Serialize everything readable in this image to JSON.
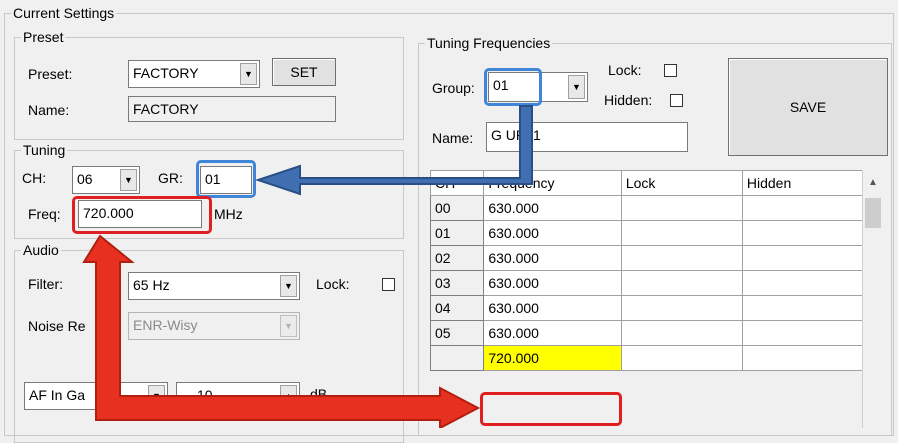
{
  "current_settings": {
    "title": "Current Settings"
  },
  "preset": {
    "title": "Preset",
    "preset_label": "Preset:",
    "preset_value": "FACTORY",
    "set_button": "SET",
    "name_label": "Name:",
    "name_value": "FACTORY"
  },
  "tuning": {
    "title": "Tuning",
    "ch_label": "CH:",
    "ch_value": "06",
    "gr_label": "GR:",
    "gr_value": "01",
    "freq_label": "Freq:",
    "freq_value": "720.000",
    "freq_unit": "MHz"
  },
  "audio": {
    "title": "Audio",
    "filter_label": "Filter:",
    "filter_value": "65 Hz",
    "lock_label": "Lock:",
    "noise_label": "Noise Re",
    "noise_value": "ENR-Wisy",
    "af_label": "AF In Ga",
    "af_value": "10",
    "af_unit": "dB"
  },
  "tuning_frequencies": {
    "title": "Tuning Frequencies",
    "group_label": "Group:",
    "group_value": "01",
    "lock_label": "Lock:",
    "hidden_label": "Hidden:",
    "name_label": "Name:",
    "name_value": "G   UP01",
    "save_button": "SAVE",
    "columns": [
      "CH",
      "Frequency",
      "Lock",
      "Hidden"
    ],
    "rows": [
      {
        "ch": "00",
        "freq": "630.000"
      },
      {
        "ch": "01",
        "freq": "630.000"
      },
      {
        "ch": "02",
        "freq": "630.000"
      },
      {
        "ch": "03",
        "freq": "630.000"
      },
      {
        "ch": "04",
        "freq": "630.000"
      },
      {
        "ch": "05",
        "freq": "630.000"
      },
      {
        "ch": "",
        "freq": "720.000"
      }
    ]
  },
  "colors": {
    "highlight_yellow": "#ffff00",
    "arrow_blue": "#3f6fb0",
    "arrow_red": "#e83020",
    "outline_blue": "#3f86d8",
    "outline_red": "#e02020"
  }
}
